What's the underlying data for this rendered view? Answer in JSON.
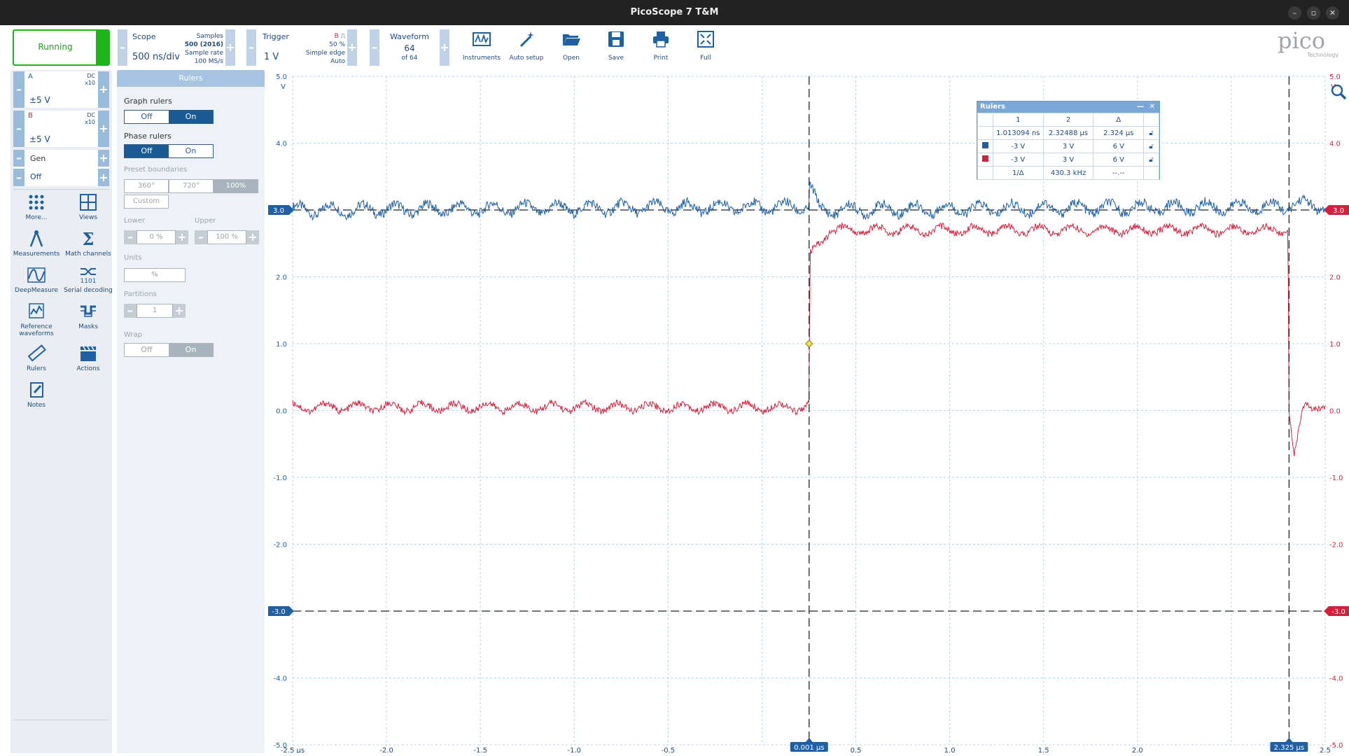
{
  "window": {
    "title": "PicoScope 7 T&M"
  },
  "toolbar": {
    "running_label": "Running",
    "scope": {
      "title": "Scope",
      "timebase": "500 ns/div",
      "samples_label": "Samples",
      "samples_value": "500 (2016)",
      "rate_label": "Sample rate",
      "rate_value": "100 MS/s"
    },
    "trigger": {
      "title": "Trigger",
      "source": "B",
      "level_pct": "50 %",
      "mode": "Simple edge",
      "auto": "Auto",
      "level": "1 V"
    },
    "waveform": {
      "title": "Waveform",
      "current": "64",
      "of": "of 64"
    },
    "tools": [
      "Instruments",
      "Auto setup",
      "Open",
      "Save",
      "Print",
      "Full"
    ],
    "logo": "pico",
    "logo_sub": "Technology"
  },
  "channels": [
    {
      "name": "A",
      "coupling": "DC",
      "probe": "x10",
      "range": "±5 V",
      "color": "#1f5fa3"
    },
    {
      "name": "B",
      "coupling": "DC",
      "probe": "x10",
      "range": "±5 V",
      "color": "#d61f3c"
    }
  ],
  "gen": {
    "label": "Gen",
    "value": "Off"
  },
  "left_tools": [
    "More...",
    "Views",
    "Measurements",
    "Math channels",
    "DeepMeasure",
    "Serial decoding",
    "Reference waveforms",
    "Masks",
    "Rulers",
    "Actions",
    "Notes"
  ],
  "rulers_panel": {
    "header": "Rulers",
    "graph_rulers": "Graph rulers",
    "phase_rulers": "Phase rulers",
    "off": "Off",
    "on": "On",
    "preset_boundaries": "Preset boundaries",
    "presets": [
      "360°",
      "720°",
      "100%"
    ],
    "custom": "Custom",
    "lower_label": "Lower",
    "lower_value": "0 %",
    "upper_label": "Upper",
    "upper_value": "100 %",
    "units_label": "Units",
    "units_value": "%",
    "partitions_label": "Partitions",
    "partitions_value": "1",
    "wrap_label": "Wrap"
  },
  "rulers_window": {
    "title": "Rulers",
    "headers": [
      "1",
      "2",
      "Δ"
    ],
    "time_row": [
      "1.013094 ns",
      "2.32488 μs",
      "2.324 μs"
    ],
    "rowA": [
      "-3 V",
      "3 V",
      "6 V"
    ],
    "rowB": [
      "-3 V",
      "3 V",
      "6 V"
    ],
    "freq_row": [
      "1/Δ",
      "430.3 kHz",
      "--.--"
    ]
  },
  "chart_data": {
    "type": "line",
    "x_axis": {
      "range": [
        -2.5,
        2.5
      ],
      "ticks": [
        "-2.5 μs",
        "-2.0",
        "-1.5",
        "-1.0",
        "-0.5",
        "0.001 μs",
        "0.5",
        "1.0",
        "1.5",
        "2.0",
        "2.325 μs",
        "2.5"
      ]
    },
    "y_axis_left": {
      "range": [
        -5,
        5
      ],
      "unit": "V",
      "ticks": [
        "5.0",
        "4.0",
        "3.0",
        "2.0",
        "1.0",
        "0.0",
        "-1.0",
        "-2.0",
        "-3.0",
        "-4.0",
        "-5.0"
      ]
    },
    "y_axis_right": {
      "range": [
        -5,
        5
      ],
      "unit": "V",
      "ticks": [
        "5.0",
        "4.0",
        "3.0",
        "2.0",
        "1.0",
        "0.0",
        "-1.0",
        "-2.0",
        "-3.0",
        "-4.0",
        "-5.0"
      ]
    },
    "grid": true,
    "h_rulers": [
      "3.0",
      "-3.0"
    ],
    "time_rulers": [
      "0.001 μs",
      "2.325 μs"
    ],
    "trigger_marker": {
      "x": 0.001,
      "y": 1.0
    },
    "series": [
      {
        "name": "A",
        "color": "#1f5fa3",
        "points": [
          [
            -2.5,
            3.0
          ],
          [
            0.0,
            3.05
          ],
          [
            0.001,
            3.4
          ],
          [
            0.05,
            3.0
          ],
          [
            2.32,
            3.05
          ],
          [
            2.325,
            3.1
          ],
          [
            2.5,
            3.05
          ]
        ]
      },
      {
        "name": "B",
        "color": "#d61f3c",
        "points": [
          [
            -2.5,
            0.05
          ],
          [
            0.0,
            0.05
          ],
          [
            0.001,
            -0.1
          ],
          [
            0.005,
            2.3
          ],
          [
            0.1,
            2.7
          ],
          [
            2.32,
            2.7
          ],
          [
            2.325,
            0.0
          ],
          [
            2.35,
            -0.7
          ],
          [
            2.4,
            0.1
          ],
          [
            2.5,
            0.05
          ]
        ]
      }
    ]
  }
}
